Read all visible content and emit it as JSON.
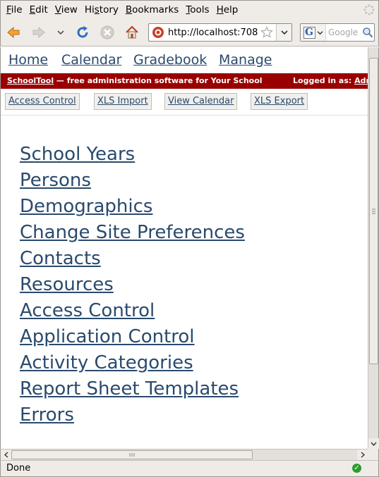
{
  "menubar": {
    "items": [
      {
        "pre": "",
        "key": "F",
        "post": "ile"
      },
      {
        "pre": "",
        "key": "E",
        "post": "dit"
      },
      {
        "pre": "",
        "key": "V",
        "post": "iew"
      },
      {
        "pre": "Hi",
        "key": "s",
        "post": "tory"
      },
      {
        "pre": "",
        "key": "B",
        "post": "ookmarks"
      },
      {
        "pre": "",
        "key": "T",
        "post": "ools"
      },
      {
        "pre": "",
        "key": "H",
        "post": "elp"
      }
    ]
  },
  "toolbar": {
    "url": "http://localhost:708",
    "search_placeholder": "Google",
    "search_engine_letter": "G"
  },
  "site_nav": {
    "home": "Home",
    "calendar": "Calendar",
    "gradebook": "Gradebook",
    "manage": "Manage"
  },
  "banner": {
    "brand": "SchoolTool",
    "tagline": " — free administration software for Your School",
    "logged_in_label": "Logged in as: ",
    "user": "Administrator"
  },
  "actions": {
    "access_control": "Access Control",
    "xls_import": "XLS Import",
    "view_calendar": "View Calendar",
    "xls_export": "XLS Export"
  },
  "manage_links": [
    "School Years",
    "Persons",
    "Demographics",
    "Change Site Preferences",
    "Contacts",
    "Resources",
    "Access Control",
    "Application Control",
    "Activity Categories",
    "Report Sheet Templates",
    "Errors"
  ],
  "status": {
    "text": "Done"
  },
  "colors": {
    "banner_bg": "#990000",
    "link": "#2a4a6d",
    "chrome_bg": "#efebe7"
  }
}
